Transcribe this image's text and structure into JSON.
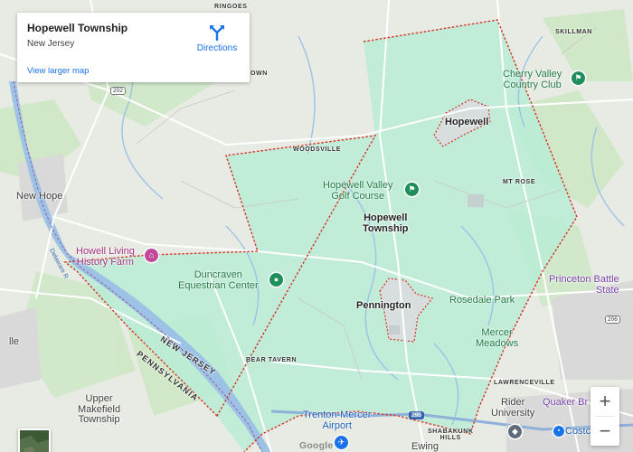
{
  "info_card": {
    "title": "Hopewell Township",
    "subtitle": "New Jersey",
    "larger_map_link": "View larger map",
    "directions_label": "Directions"
  },
  "labels": {
    "ringoes": "RINGOES",
    "skillman": "SKILLMAN",
    "cherry_valley": "Cherry Valley\nCountry Club",
    "hopewell": "Hopewell",
    "woodsville": "WOODSVILLE",
    "hopewell_valley_golf": "Hopewell Valley\nGolf Course",
    "mt_rose": "MT ROSE",
    "hopewell_township": "Hopewell\nTownship",
    "new_hope": "New Hope",
    "howell_farm": "Howell Living\nHistory Farm",
    "duncraven": "Duncraven\nEquestrian Center",
    "pennington": "Pennington",
    "rosedale_park": "Rosedale Park",
    "princeton_battle": "Princeton Battle\nState",
    "mercer_meadows": "Mercer\nMeadows",
    "new_jersey": "NEW JERSEY",
    "pennsylvania": "PENNSYLVANIA",
    "bear_tavern": "BEAR TAVERN",
    "lawrenceville": "LAWRENCEVILLE",
    "upper_makefield": "Upper\nMakefield\nTownship",
    "trenton_mercer": "Trenton-Mercer\nAirport",
    "rider_university": "Rider\nUniversity",
    "quaker_bridge": "Quaker Br",
    "shabakunk": "SHABAKUNK\nHILLS",
    "ewing": "Ewing",
    "costco": "Costc",
    "delaware_river": "Delaware R",
    "ille": "lle",
    "own": "OWN"
  },
  "shields": {
    "r202": "202",
    "r206": "206",
    "r295": "295"
  },
  "controls": {
    "zoom_in": "+",
    "zoom_out": "−"
  },
  "attribution": "Google",
  "icons": {
    "directions": "directions-arrow-icon",
    "golf": "golf-flag-icon",
    "farm": "farm-museum-icon",
    "equestrian": "park-pin-icon",
    "airport": "airport-icon",
    "university": "university-icon",
    "shopping": "shopping-bag-icon"
  },
  "colors": {
    "boundary": "#d93025",
    "township_fill": "#b9ecd6",
    "water": "#9cc3e6",
    "directions_blue": "#1a73e8"
  }
}
